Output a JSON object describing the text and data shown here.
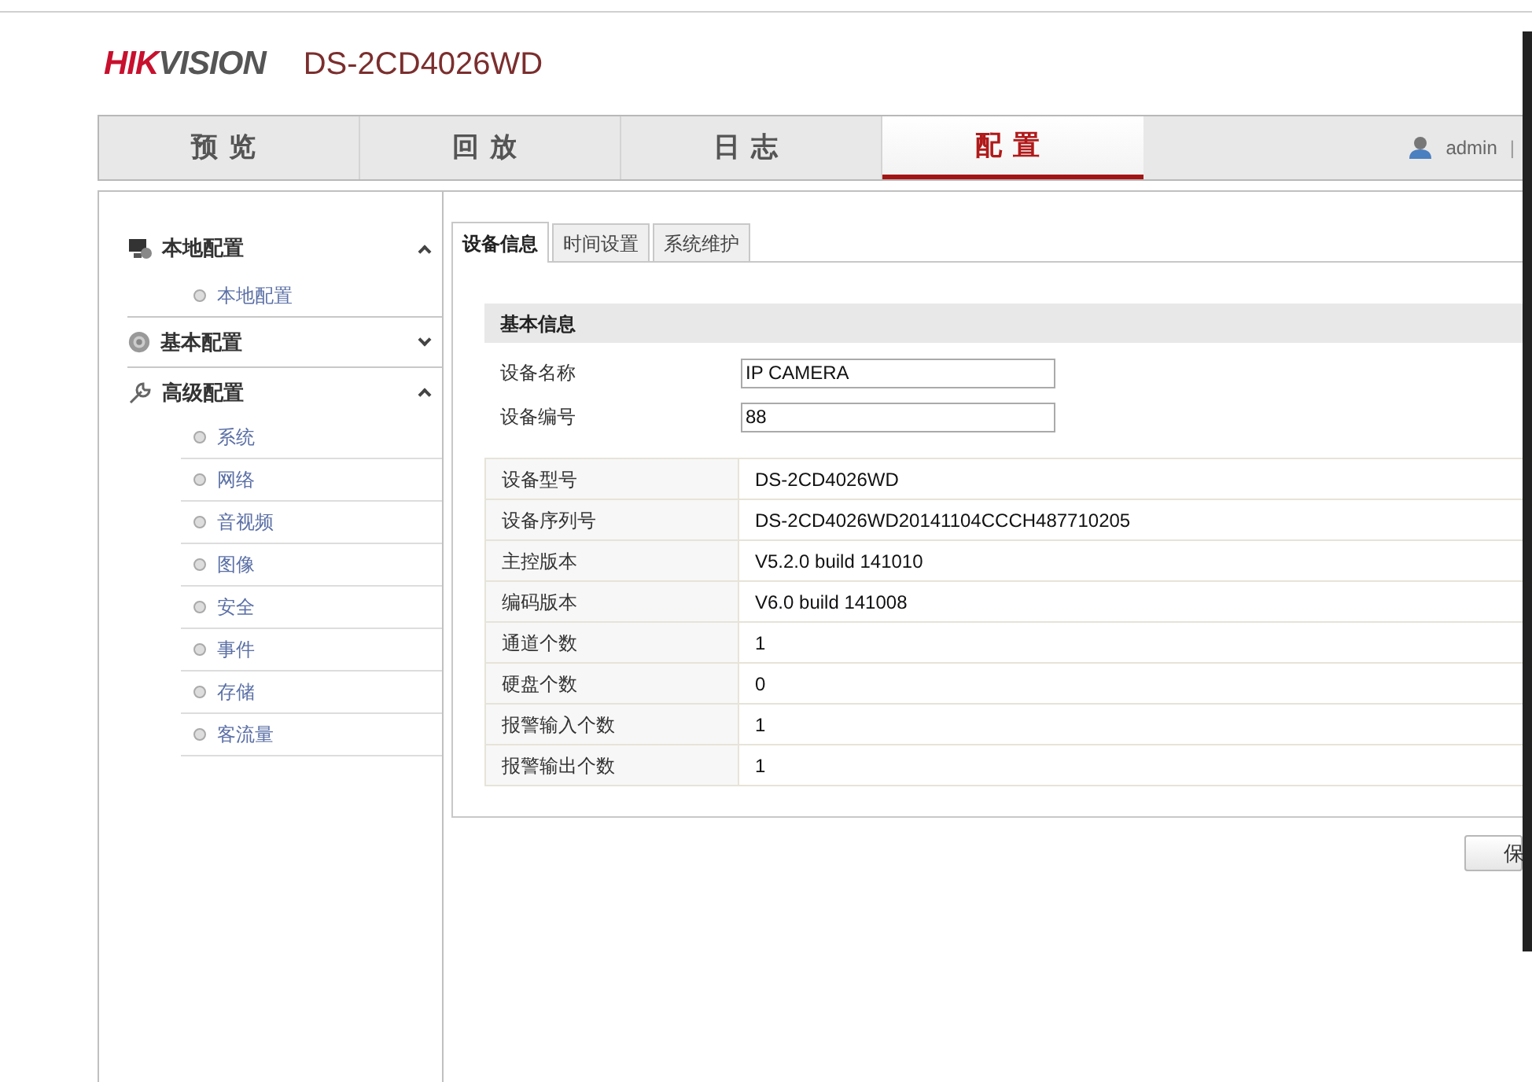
{
  "header": {
    "logo": "HIKVISION",
    "model": "DS-2CD4026WD"
  },
  "nav": {
    "tabs": [
      {
        "label": "预览",
        "selected": false
      },
      {
        "label": "回放",
        "selected": false
      },
      {
        "label": "日志",
        "selected": false
      },
      {
        "label": "配置",
        "selected": true
      }
    ],
    "user": "admin",
    "separator": "|"
  },
  "sidebar": {
    "groups": [
      {
        "label": "本地配置",
        "kind": "monitor",
        "expanded": true,
        "children": [
          {
            "label": "本地配置"
          }
        ]
      },
      {
        "label": "基本配置",
        "kind": "gear",
        "expanded": false
      },
      {
        "label": "高级配置",
        "kind": "wrench",
        "expanded": true,
        "children": [
          {
            "label": "系统"
          },
          {
            "label": "网络"
          },
          {
            "label": "音视频"
          },
          {
            "label": "图像"
          },
          {
            "label": "安全"
          },
          {
            "label": "事件"
          },
          {
            "label": "存储"
          },
          {
            "label": "客流量"
          }
        ]
      }
    ]
  },
  "tabs": [
    {
      "label": "设备信息",
      "selected": true
    },
    {
      "label": "时间设置",
      "selected": false
    },
    {
      "label": "系统维护",
      "selected": false
    }
  ],
  "section_title": "基本信息",
  "fields": [
    {
      "label": "设备名称",
      "value": "IP CAMERA"
    },
    {
      "label": "设备编号",
      "value": "88"
    }
  ],
  "info_rows": [
    {
      "label": "设备型号",
      "value": "DS-2CD4026WD"
    },
    {
      "label": "设备序列号",
      "value": "DS-2CD4026WD20141104CCCH487710205"
    },
    {
      "label": "主控版本",
      "value": "V5.2.0 build 141010"
    },
    {
      "label": "编码版本",
      "value": "V6.0 build 141008"
    },
    {
      "label": "通道个数",
      "value": "1"
    },
    {
      "label": "硬盘个数",
      "value": "0"
    },
    {
      "label": "报警输入个数",
      "value": "1"
    },
    {
      "label": "报警输出个数",
      "value": "1"
    }
  ],
  "save_button": "保"
}
